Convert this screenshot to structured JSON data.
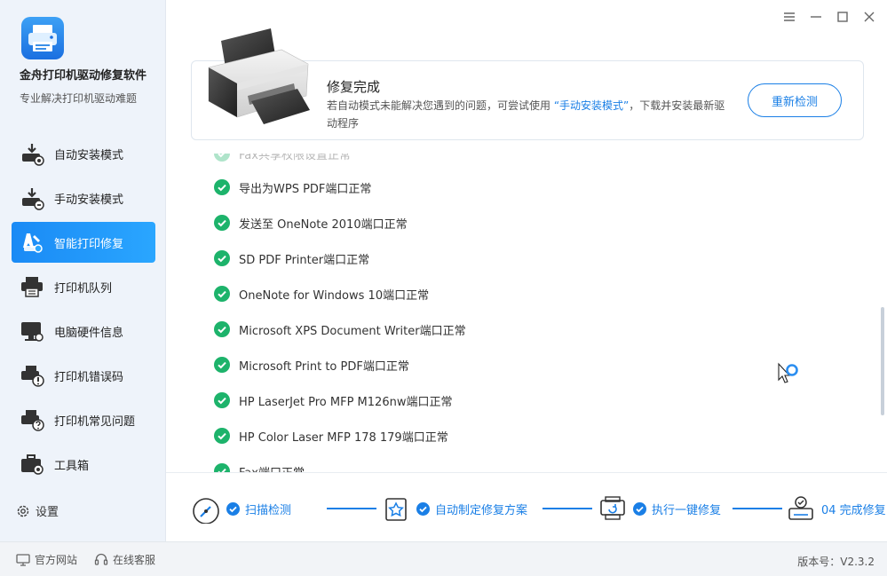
{
  "app": {
    "title": "金舟打印机驱动修复软件",
    "subtitle": "专业解决打印机驱动难题"
  },
  "sidebar": {
    "items": [
      {
        "label": "自动安装模式",
        "icon": "download-printer-icon",
        "active": false
      },
      {
        "label": "手动安装模式",
        "icon": "manual-install-icon",
        "active": false
      },
      {
        "label": "智能打印修复",
        "icon": "repair-tools-icon",
        "active": true
      },
      {
        "label": "打印机队列",
        "icon": "printer-queue-icon",
        "active": false
      },
      {
        "label": "电脑硬件信息",
        "icon": "monitor-icon",
        "active": false
      },
      {
        "label": "打印机错误码",
        "icon": "error-code-icon",
        "active": false
      },
      {
        "label": "打印机常见问题",
        "icon": "faq-icon",
        "active": false
      },
      {
        "label": "工具箱",
        "icon": "toolbox-icon",
        "active": false
      }
    ],
    "settings_label": "设置"
  },
  "banner": {
    "title": "修复完成",
    "desc_before": "若自动模式未能解决您遇到的问题，可尝试使用 ",
    "desc_link": "“手动安装模式”",
    "desc_after": "，下载并安装最新驱动程序",
    "button": "重新检测"
  },
  "results": [
    "Fax共享权限设置正常",
    "导出为WPS PDF端口正常",
    "发送至 OneNote 2010端口正常",
    "SD PDF Printer端口正常",
    "OneNote for Windows 10端口正常",
    "Microsoft XPS Document Writer端口正常",
    "Microsoft Print to PDF端口正常",
    "HP LaserJet Pro MFP M126nw端口正常",
    "HP Color Laser MFP 178 179端口正常",
    "Fax端口正常"
  ],
  "steps": [
    {
      "label": "扫描检测",
      "icon": "scan-gauge-icon"
    },
    {
      "label": "自动制定修复方案",
      "icon": "plan-star-icon"
    },
    {
      "label": "执行一键修复",
      "icon": "one-click-repair-icon"
    },
    {
      "label": "04 完成修复",
      "icon": "complete-icon"
    }
  ],
  "footer": {
    "website": "官方网站",
    "support": "在线客服",
    "version": "版本号：V2.3.2"
  },
  "colors": {
    "accent": "#1a7fe6",
    "success": "#1db36b",
    "active_nav": "#1a8af5"
  }
}
